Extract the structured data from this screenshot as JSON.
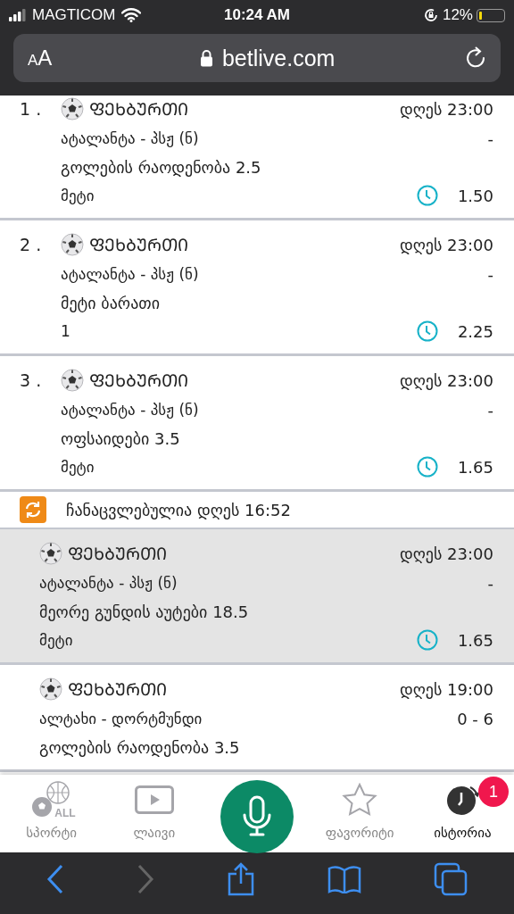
{
  "status_bar": {
    "carrier": "MAGTICOM",
    "time": "10:24 AM",
    "battery": "12%"
  },
  "browser": {
    "text_size": "AA",
    "url": "betlive.com"
  },
  "items": [
    {
      "kind": "bet",
      "selected": false,
      "number": "1 .",
      "sport": "ᲤᲔᲮᲑᲣᲠᲗᲘ",
      "time": "დღეს 23:00",
      "match": "ატალანტა - პსჟ (ნ)",
      "score": "-",
      "market": "გოლების რაოდენობა 2.5",
      "pick": "მეტი",
      "odds": "1.50"
    },
    {
      "kind": "bet",
      "selected": false,
      "number": "2 .",
      "sport": "ᲤᲔᲮᲑᲣᲠᲗᲘ",
      "time": "დღეს 23:00",
      "match": "ატალანტა - პსჟ (ნ)",
      "score": "-",
      "market": "მეტი ბარათი",
      "pick": "1",
      "odds": "2.25"
    },
    {
      "kind": "bet",
      "selected": false,
      "number": "3 .",
      "sport": "ᲤᲔᲮᲑᲣᲠᲗᲘ",
      "time": "დღეს 23:00",
      "match": "ატალანტა - პსჟ (ნ)",
      "score": "-",
      "market": "ოფსაიდები 3.5",
      "pick": "მეტი",
      "odds": "1.65"
    },
    {
      "kind": "notice",
      "text": "ჩანაცვლებულია დღეს 16:52"
    },
    {
      "kind": "bet",
      "selected": true,
      "sport": "ᲤᲔᲮᲑᲣᲠᲗᲘ",
      "time": "დღეს 23:00",
      "match": "ატალანტა - პსჟ (ნ)",
      "score": "-",
      "market": "მეორე გუნდის აუტები 18.5",
      "pick": "მეტი",
      "odds": "1.65"
    },
    {
      "kind": "bet",
      "selected": false,
      "sport": "ᲤᲔᲮᲑᲣᲠᲗᲘ",
      "time": "დღეს 19:00",
      "match": "ალტახი - დორტმუნდი",
      "score": "0 - 6",
      "market": "გოლების რაოდენობა 3.5"
    }
  ],
  "tabs": [
    {
      "kind": "sports",
      "label": "სპორტი",
      "icon_text": "ALL",
      "selected": false
    },
    {
      "kind": "live",
      "label": "ლაივი",
      "selected": false
    },
    {
      "kind": "mic"
    },
    {
      "kind": "favorites",
      "label": "ფავორიტი",
      "selected": false
    },
    {
      "kind": "history",
      "label": "ისტორია",
      "selected": true,
      "badge": "1"
    }
  ]
}
